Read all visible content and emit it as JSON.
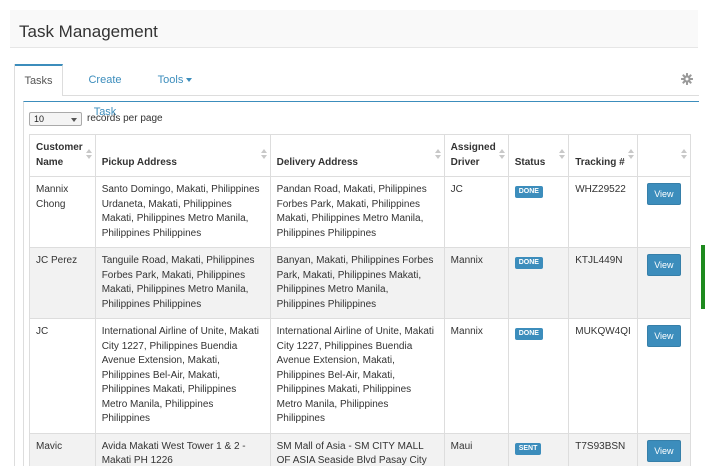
{
  "header": {
    "title": "Task Management"
  },
  "tabs": [
    {
      "label": "Tasks",
      "active": true
    },
    {
      "label": "Create Task"
    },
    {
      "label": "Tools"
    }
  ],
  "tools_icon": "gear-icon",
  "length": {
    "value": "10",
    "label": "records per page"
  },
  "table": {
    "columns": [
      "Customer Name",
      "Pickup Address",
      "Delivery Address",
      "Assigned Driver",
      "Status",
      "Tracking #",
      ""
    ],
    "rows": [
      {
        "customer": "Mannix Chong",
        "pickup": "Santo Domingo, Makati, Philippines Urdaneta, Makati, Philippines Makati, Philippines Metro Manila, Philippines Philippines",
        "delivery": "Pandan Road, Makati, Philippines Forbes Park, Makati, Philippines Makati, Philippines Metro Manila, Philippines Philippines",
        "driver": "JC",
        "status": "DONE",
        "tracking": "WHZ29522",
        "action": "View"
      },
      {
        "customer": "JC Perez",
        "pickup": "Tanguile Road, Makati, Philippines Forbes Park, Makati, Philippines Makati, Philippines Metro Manila, Philippines Philippines",
        "delivery": "Banyan, Makati, Philippines Forbes Park, Makati, Philippines Makati, Philippines Metro Manila, Philippines Philippines",
        "driver": "Mannix",
        "status": "DONE",
        "tracking": "KTJL449N",
        "action": "View"
      },
      {
        "customer": "JC",
        "pickup": "International Airline of Unite, Makati City 1227, Philippines Buendia Avenue Extension, Makati, Philippines Bel-Air, Makati, Philippines Makati, Philippines Metro Manila, Philippines Philippines",
        "delivery": "International Airline of Unite, Makati City 1227, Philippines Buendia Avenue Extension, Makati, Philippines Bel-Air, Makati, Philippines Makati, Philippines Metro Manila, Philippines Philippines",
        "driver": "Mannix",
        "status": "DONE",
        "tracking": "MUKQW4QI",
        "action": "View"
      },
      {
        "customer": "Mavic",
        "pickup": "Avida Makati West Tower 1 & 2 - Makati PH 1226",
        "delivery": "SM Mall of Asia - SM CITY MALL OF ASIA Seaside Blvd Pasay City",
        "driver": "Maui",
        "status": "SENT",
        "tracking": "T7S93BSN",
        "action": "View"
      }
    ]
  },
  "colors": {
    "accent": "#3c8dbc",
    "side_bar": "#1e8a1e"
  }
}
